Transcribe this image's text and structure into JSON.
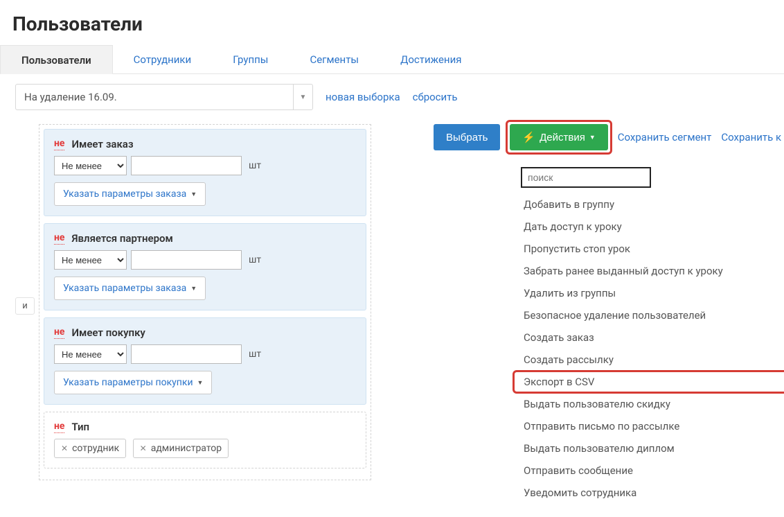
{
  "page": {
    "title": "Пользователи"
  },
  "tabs": [
    {
      "label": "Пользователи",
      "active": true
    },
    {
      "label": "Сотрудники",
      "active": false
    },
    {
      "label": "Группы",
      "active": false
    },
    {
      "label": "Сегменты",
      "active": false
    },
    {
      "label": "Достижения",
      "active": false
    }
  ],
  "filter": {
    "selected": "На удаление 16.09.",
    "new_selection": "новая выборка",
    "reset": "сбросить"
  },
  "conj": {
    "label": "и"
  },
  "conditions": {
    "ne": "не",
    "unit": "шт",
    "blocks": [
      {
        "title": "Имеет заказ",
        "op": "Не менее",
        "specify": "Указать параметры заказа",
        "bg": "blue"
      },
      {
        "title": "Является партнером",
        "op": "Не менее",
        "specify": "Указать параметры заказа",
        "bg": "blue"
      },
      {
        "title": "Имеет покупку",
        "op": "Не менее",
        "specify": "Указать параметры покупки",
        "bg": "blue"
      }
    ],
    "type_block": {
      "title": "Тип",
      "chips": [
        "сотрудник",
        "администратор"
      ]
    }
  },
  "toolbar": {
    "select": "Выбрать",
    "actions": "Действия",
    "save_segment": "Сохранить сегмент",
    "save_as": "Сохранить к"
  },
  "dropdown": {
    "search_placeholder": "поиск",
    "items": [
      "Добавить в группу",
      "Дать доступ к уроку",
      "Пропустить стоп урок",
      "Забрать ранее выданный доступ к уроку",
      "Удалить из группы",
      "Безопасное удаление пользователей",
      "Создать заказ",
      "Создать рассылку",
      "Экспорт в CSV",
      "Выдать пользователю скидку",
      "Отправить письмо по рассылке",
      "Выдать пользователю диплом",
      "Отправить сообщение",
      "Уведомить сотрудника"
    ],
    "highlight_index": 8
  }
}
